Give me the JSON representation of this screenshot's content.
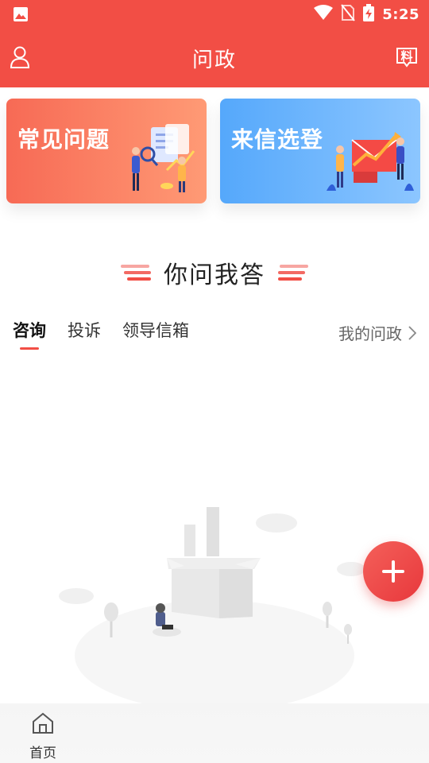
{
  "status_bar": {
    "time": "5:25",
    "icons": [
      "gallery-icon",
      "wifi-icon",
      "no-sim-icon",
      "battery-charging-icon"
    ]
  },
  "header": {
    "title": "问政",
    "left_icon": "user-icon",
    "right_icon_text": "料"
  },
  "cards": [
    {
      "label": "常见问题",
      "color": "#f76a55"
    },
    {
      "label": "来信选登",
      "color": "#55a8fb"
    }
  ],
  "section": {
    "title": "你问我答"
  },
  "tabs": [
    {
      "label": "咨询",
      "active": true
    },
    {
      "label": "投诉",
      "active": false
    },
    {
      "label": "领导信箱",
      "active": false
    }
  ],
  "my_link": "我的问政",
  "bottom_nav": [
    {
      "label": "首页",
      "icon": "home-icon"
    }
  ],
  "colors": {
    "brand": "#f24e45",
    "accent_blue": "#55a8fb"
  }
}
